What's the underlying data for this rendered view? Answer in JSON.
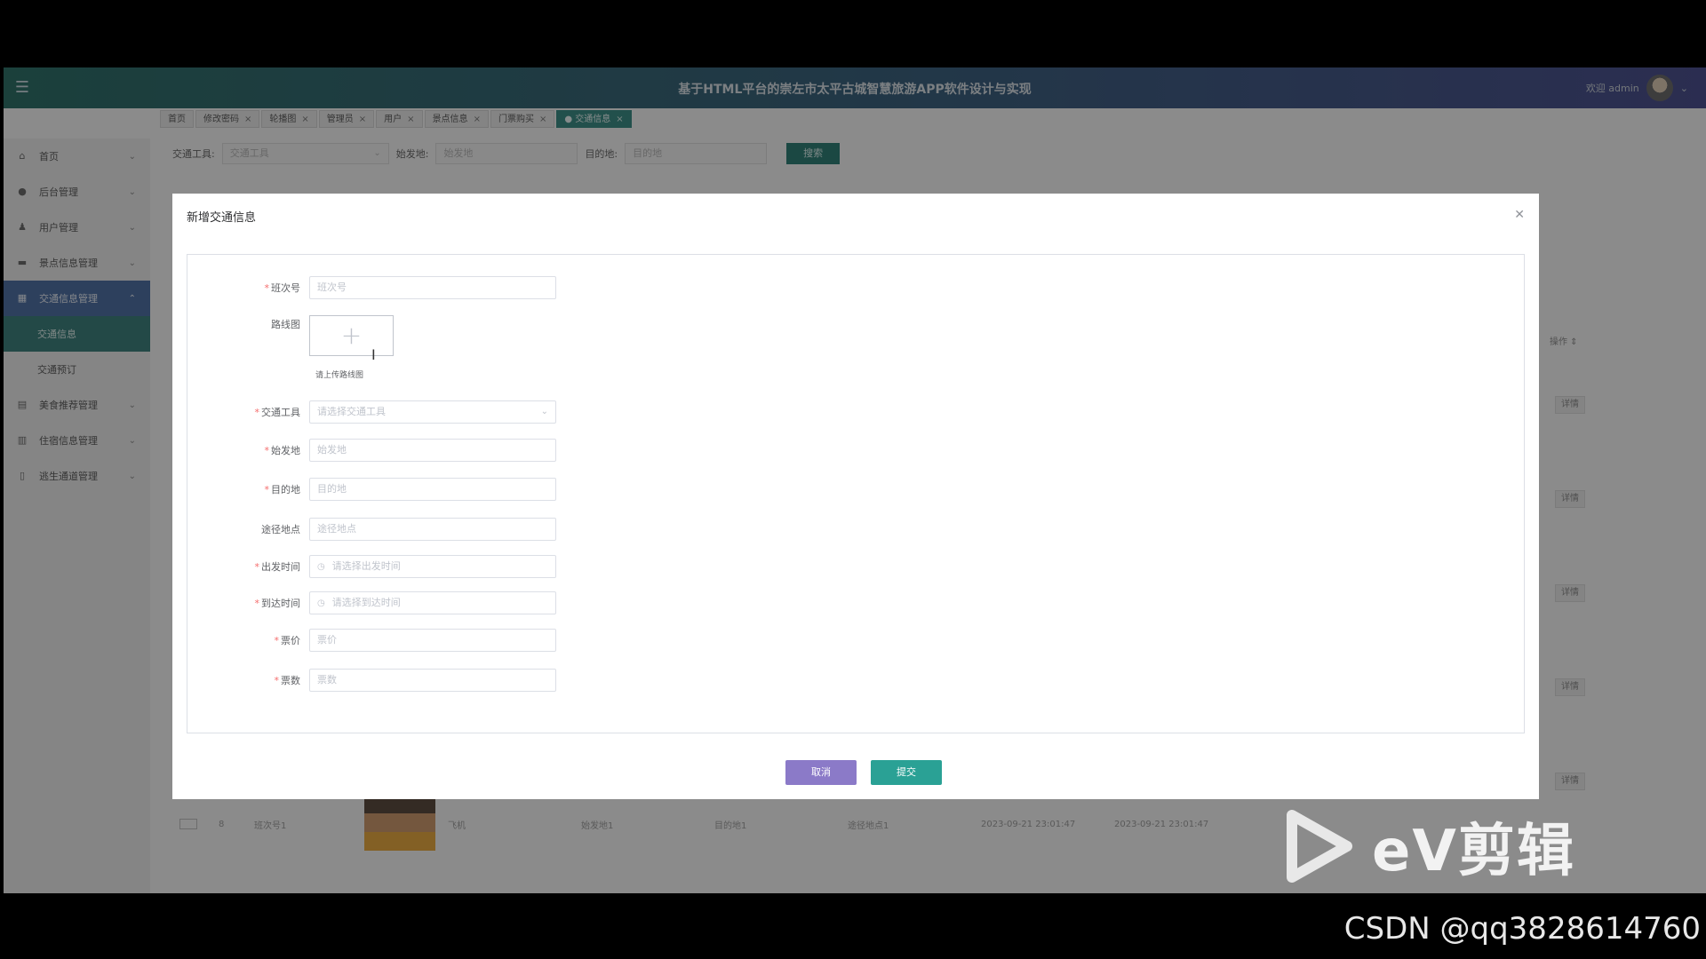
{
  "app": {
    "title": "基于HTML平台的崇左市太平古城智慧旅游APP软件设计与实现",
    "user_greeting": "欢迎 admin"
  },
  "tabs": [
    {
      "label": "首页",
      "closable": false,
      "active": false
    },
    {
      "label": "修改密码",
      "closable": true,
      "active": false
    },
    {
      "label": "轮播图",
      "closable": true,
      "active": false
    },
    {
      "label": "管理员",
      "closable": true,
      "active": false
    },
    {
      "label": "用户",
      "closable": true,
      "active": false
    },
    {
      "label": "景点信息",
      "closable": true,
      "active": false
    },
    {
      "label": "门票购买",
      "closable": true,
      "active": false
    },
    {
      "label": "● 交通信息",
      "closable": true,
      "active": true
    }
  ],
  "sidebar": {
    "items": [
      {
        "label": "首页",
        "icon": "home-icon"
      },
      {
        "label": "后台管理",
        "icon": "gear-icon"
      },
      {
        "label": "用户管理",
        "icon": "user-icon"
      },
      {
        "label": "景点信息管理",
        "icon": "folder-icon"
      },
      {
        "label": "交通信息管理",
        "icon": "grid-icon",
        "active": true
      },
      {
        "label": "美食推荐管理",
        "icon": "food-icon"
      },
      {
        "label": "住宿信息管理",
        "icon": "building-icon"
      },
      {
        "label": "逃生通道管理",
        "icon": "door-icon"
      }
    ],
    "subitems": [
      {
        "label": "交通信息",
        "active": true
      },
      {
        "label": "交通预订",
        "active": false
      }
    ]
  },
  "search": {
    "vehicle_label": "交通工具:",
    "vehicle_placeholder": "交通工具",
    "origin_label": "始发地:",
    "origin_placeholder": "始发地",
    "dest_label": "目的地:",
    "dest_placeholder": "目的地",
    "search_button": "搜索"
  },
  "background_table": {
    "op_header": "操作 ⇕",
    "detail_label": "详情",
    "row": {
      "index": "8",
      "shift": "班次号1",
      "vehicle": "飞机",
      "origin": "始发地1",
      "dest": "目的地1",
      "via": "途径地点1",
      "depart": "2023-09-21 23:01:47",
      "arrive": "2023-09-21 23:01:47"
    }
  },
  "modal": {
    "title": "新增交通信息",
    "fields": {
      "shift": {
        "label": "班次号",
        "placeholder": "班次号"
      },
      "route": {
        "label": "路线图",
        "hint": "请上传路线图"
      },
      "vehicle": {
        "label": "交通工具",
        "placeholder": "请选择交通工具"
      },
      "origin": {
        "label": "始发地",
        "placeholder": "始发地"
      },
      "dest": {
        "label": "目的地",
        "placeholder": "目的地"
      },
      "via": {
        "label": "途径地点",
        "placeholder": "途径地点"
      },
      "depart": {
        "label": "出发时间",
        "placeholder": "请选择出发时间"
      },
      "arrive": {
        "label": "到达时间",
        "placeholder": "请选择到达时间"
      },
      "price": {
        "label": "票价",
        "placeholder": "票价"
      },
      "count": {
        "label": "票数",
        "placeholder": "票数"
      }
    },
    "cancel": "取消",
    "submit": "提交"
  },
  "watermark": {
    "ev_text": "eV剪辑",
    "csdn_text": "CSDN @qq3828614760"
  },
  "colors": {
    "topbar_start": "#2f6e67",
    "topbar_end": "#4b4f8c",
    "accent_teal": "#2aa195",
    "cancel_purple": "#8b7ac8",
    "required_red": "#f56c6c"
  }
}
